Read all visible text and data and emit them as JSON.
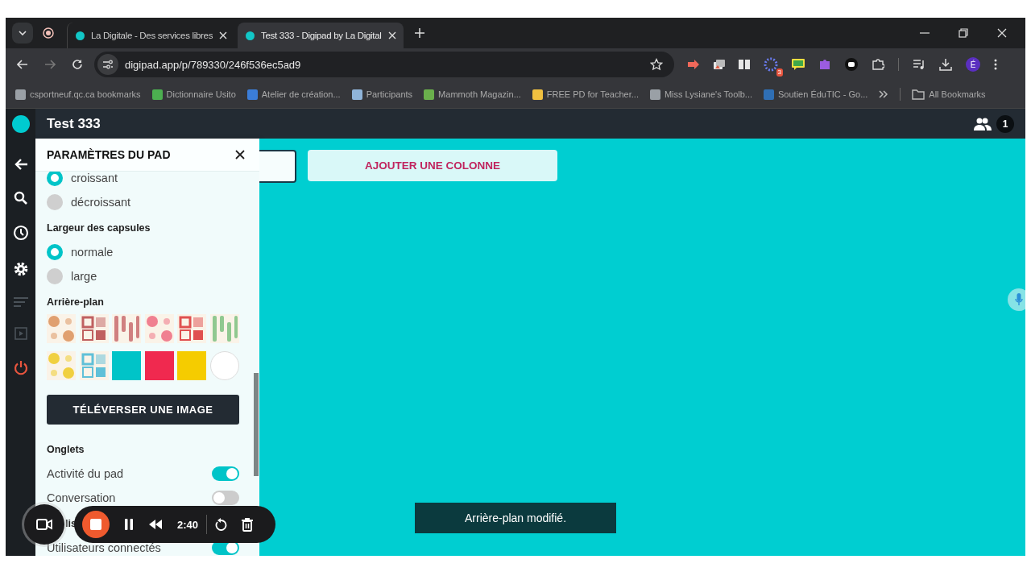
{
  "browser": {
    "tabs": [
      {
        "title": "La Digitale - Des services libres",
        "selected": false
      },
      {
        "title": "Test 333 - Digipad by La Digital",
        "selected": true
      }
    ],
    "address": "digipad.app/p/789330/246f536ec5ad9",
    "extension_badge": "3",
    "profile_initial": "É",
    "bookmarks": [
      {
        "label": "csportneuf.qc.ca bookmarks",
        "color": "#9aa0a6"
      },
      {
        "label": "Dictionnaire Usito",
        "color": "#4caf50"
      },
      {
        "label": "Atelier de création...",
        "color": "#3b7dd8"
      },
      {
        "label": "Participants",
        "color": "#8fb4d9"
      },
      {
        "label": "Mammoth Magazin...",
        "color": "#6ab04c"
      },
      {
        "label": "FREE PD for Teacher...",
        "color": "#f0c040"
      },
      {
        "label": "Miss Lysiane's Toolb...",
        "color": "#9aa0a6"
      },
      {
        "label": "Soutien ÉduTIC - Go...",
        "color": "#2f6fb5"
      }
    ],
    "all_bookmarks": "All Bookmarks"
  },
  "app": {
    "title": "Test 333",
    "users_count": "1",
    "rail": [
      {
        "kind": "back",
        "disabled": false
      },
      {
        "kind": "search",
        "disabled": false
      },
      {
        "kind": "history",
        "disabled": false
      },
      {
        "kind": "settings",
        "disabled": false
      },
      {
        "kind": "list",
        "disabled": true
      },
      {
        "kind": "play",
        "disabled": true
      },
      {
        "kind": "power",
        "disabled": false
      }
    ]
  },
  "panel": {
    "title": "PARAMÈTRES DU PAD",
    "items": [
      {
        "kind": "radio",
        "label": "croissant",
        "selected": true
      },
      {
        "kind": "radio",
        "label": "décroissant",
        "selected": false
      },
      {
        "kind": "heading",
        "text": "Largeur des capsules"
      },
      {
        "kind": "radio",
        "label": "normale",
        "selected": true
      },
      {
        "kind": "radio",
        "label": "large",
        "selected": false
      },
      {
        "kind": "heading",
        "text": "Arrière-plan"
      },
      {
        "kind": "swatches",
        "swatches": [
          {
            "kind": "pattern",
            "color": "#e0a070"
          },
          {
            "kind": "pattern",
            "color": "#c06060"
          },
          {
            "kind": "pattern",
            "color": "#d08080"
          },
          {
            "kind": "pattern",
            "color": "#f08090"
          },
          {
            "kind": "pattern",
            "color": "#e05050"
          },
          {
            "kind": "pattern",
            "color": "#90c890"
          },
          {
            "kind": "pattern",
            "color": "#f0d040"
          },
          {
            "kind": "pattern",
            "color": "#60c0d8"
          },
          {
            "kind": "solid",
            "color": "#00c4c8"
          },
          {
            "kind": "solid",
            "color": "#f0294f"
          },
          {
            "kind": "solid",
            "color": "#f5cc00"
          },
          {
            "kind": "blank",
            "color": "#ffffff"
          }
        ]
      },
      {
        "kind": "button",
        "label": "TÉLÉVERSER UNE IMAGE"
      },
      {
        "kind": "heading",
        "text": "Onglets"
      },
      {
        "kind": "toggle",
        "label": "Activité du pad",
        "on": true
      },
      {
        "kind": "toggle",
        "label": "Conversation",
        "on": false
      },
      {
        "kind": "partial_heading",
        "text": "lis"
      },
      {
        "kind": "toggle",
        "label": "Utilisateurs connectés",
        "on": true
      }
    ]
  },
  "board": {
    "add_column": "AJOUTER UNE COLONNE"
  },
  "toast": "Arrière-plan modifié.",
  "recorder": {
    "time": "2:40"
  }
}
